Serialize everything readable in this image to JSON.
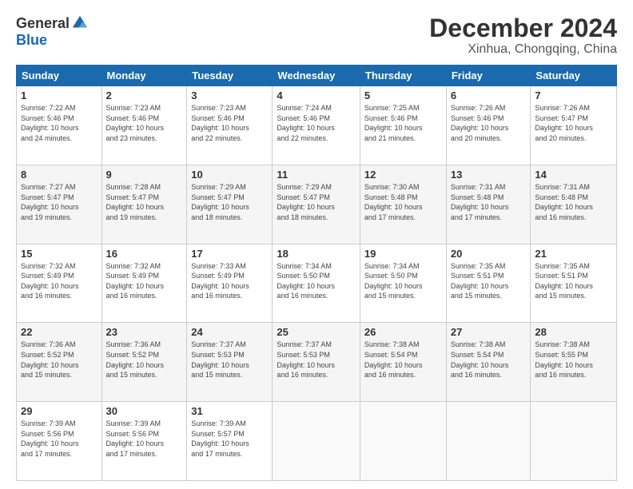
{
  "logo": {
    "general": "General",
    "blue": "Blue"
  },
  "title": "December 2024",
  "location": "Xinhua, Chongqing, China",
  "days_of_week": [
    "Sunday",
    "Monday",
    "Tuesday",
    "Wednesday",
    "Thursday",
    "Friday",
    "Saturday"
  ],
  "weeks": [
    [
      {
        "day": "1",
        "info": "Sunrise: 7:22 AM\nSunset: 5:46 PM\nDaylight: 10 hours\nand 24 minutes."
      },
      {
        "day": "2",
        "info": "Sunrise: 7:23 AM\nSunset: 5:46 PM\nDaylight: 10 hours\nand 23 minutes."
      },
      {
        "day": "3",
        "info": "Sunrise: 7:23 AM\nSunset: 5:46 PM\nDaylight: 10 hours\nand 22 minutes."
      },
      {
        "day": "4",
        "info": "Sunrise: 7:24 AM\nSunset: 5:46 PM\nDaylight: 10 hours\nand 22 minutes."
      },
      {
        "day": "5",
        "info": "Sunrise: 7:25 AM\nSunset: 5:46 PM\nDaylight: 10 hours\nand 21 minutes."
      },
      {
        "day": "6",
        "info": "Sunrise: 7:26 AM\nSunset: 5:46 PM\nDaylight: 10 hours\nand 20 minutes."
      },
      {
        "day": "7",
        "info": "Sunrise: 7:26 AM\nSunset: 5:47 PM\nDaylight: 10 hours\nand 20 minutes."
      }
    ],
    [
      {
        "day": "8",
        "info": "Sunrise: 7:27 AM\nSunset: 5:47 PM\nDaylight: 10 hours\nand 19 minutes."
      },
      {
        "day": "9",
        "info": "Sunrise: 7:28 AM\nSunset: 5:47 PM\nDaylight: 10 hours\nand 19 minutes."
      },
      {
        "day": "10",
        "info": "Sunrise: 7:29 AM\nSunset: 5:47 PM\nDaylight: 10 hours\nand 18 minutes."
      },
      {
        "day": "11",
        "info": "Sunrise: 7:29 AM\nSunset: 5:47 PM\nDaylight: 10 hours\nand 18 minutes."
      },
      {
        "day": "12",
        "info": "Sunrise: 7:30 AM\nSunset: 5:48 PM\nDaylight: 10 hours\nand 17 minutes."
      },
      {
        "day": "13",
        "info": "Sunrise: 7:31 AM\nSunset: 5:48 PM\nDaylight: 10 hours\nand 17 minutes."
      },
      {
        "day": "14",
        "info": "Sunrise: 7:31 AM\nSunset: 5:48 PM\nDaylight: 10 hours\nand 16 minutes."
      }
    ],
    [
      {
        "day": "15",
        "info": "Sunrise: 7:32 AM\nSunset: 5:49 PM\nDaylight: 10 hours\nand 16 minutes."
      },
      {
        "day": "16",
        "info": "Sunrise: 7:32 AM\nSunset: 5:49 PM\nDaylight: 10 hours\nand 16 minutes."
      },
      {
        "day": "17",
        "info": "Sunrise: 7:33 AM\nSunset: 5:49 PM\nDaylight: 10 hours\nand 16 minutes."
      },
      {
        "day": "18",
        "info": "Sunrise: 7:34 AM\nSunset: 5:50 PM\nDaylight: 10 hours\nand 16 minutes."
      },
      {
        "day": "19",
        "info": "Sunrise: 7:34 AM\nSunset: 5:50 PM\nDaylight: 10 hours\nand 15 minutes."
      },
      {
        "day": "20",
        "info": "Sunrise: 7:35 AM\nSunset: 5:51 PM\nDaylight: 10 hours\nand 15 minutes."
      },
      {
        "day": "21",
        "info": "Sunrise: 7:35 AM\nSunset: 5:51 PM\nDaylight: 10 hours\nand 15 minutes."
      }
    ],
    [
      {
        "day": "22",
        "info": "Sunrise: 7:36 AM\nSunset: 5:52 PM\nDaylight: 10 hours\nand 15 minutes."
      },
      {
        "day": "23",
        "info": "Sunrise: 7:36 AM\nSunset: 5:52 PM\nDaylight: 10 hours\nand 15 minutes."
      },
      {
        "day": "24",
        "info": "Sunrise: 7:37 AM\nSunset: 5:53 PM\nDaylight: 10 hours\nand 15 minutes."
      },
      {
        "day": "25",
        "info": "Sunrise: 7:37 AM\nSunset: 5:53 PM\nDaylight: 10 hours\nand 16 minutes."
      },
      {
        "day": "26",
        "info": "Sunrise: 7:38 AM\nSunset: 5:54 PM\nDaylight: 10 hours\nand 16 minutes."
      },
      {
        "day": "27",
        "info": "Sunrise: 7:38 AM\nSunset: 5:54 PM\nDaylight: 10 hours\nand 16 minutes."
      },
      {
        "day": "28",
        "info": "Sunrise: 7:38 AM\nSunset: 5:55 PM\nDaylight: 10 hours\nand 16 minutes."
      }
    ],
    [
      {
        "day": "29",
        "info": "Sunrise: 7:39 AM\nSunset: 5:56 PM\nDaylight: 10 hours\nand 17 minutes."
      },
      {
        "day": "30",
        "info": "Sunrise: 7:39 AM\nSunset: 5:56 PM\nDaylight: 10 hours\nand 17 minutes."
      },
      {
        "day": "31",
        "info": "Sunrise: 7:39 AM\nSunset: 5:57 PM\nDaylight: 10 hours\nand 17 minutes."
      },
      {
        "day": "",
        "info": ""
      },
      {
        "day": "",
        "info": ""
      },
      {
        "day": "",
        "info": ""
      },
      {
        "day": "",
        "info": ""
      }
    ]
  ]
}
